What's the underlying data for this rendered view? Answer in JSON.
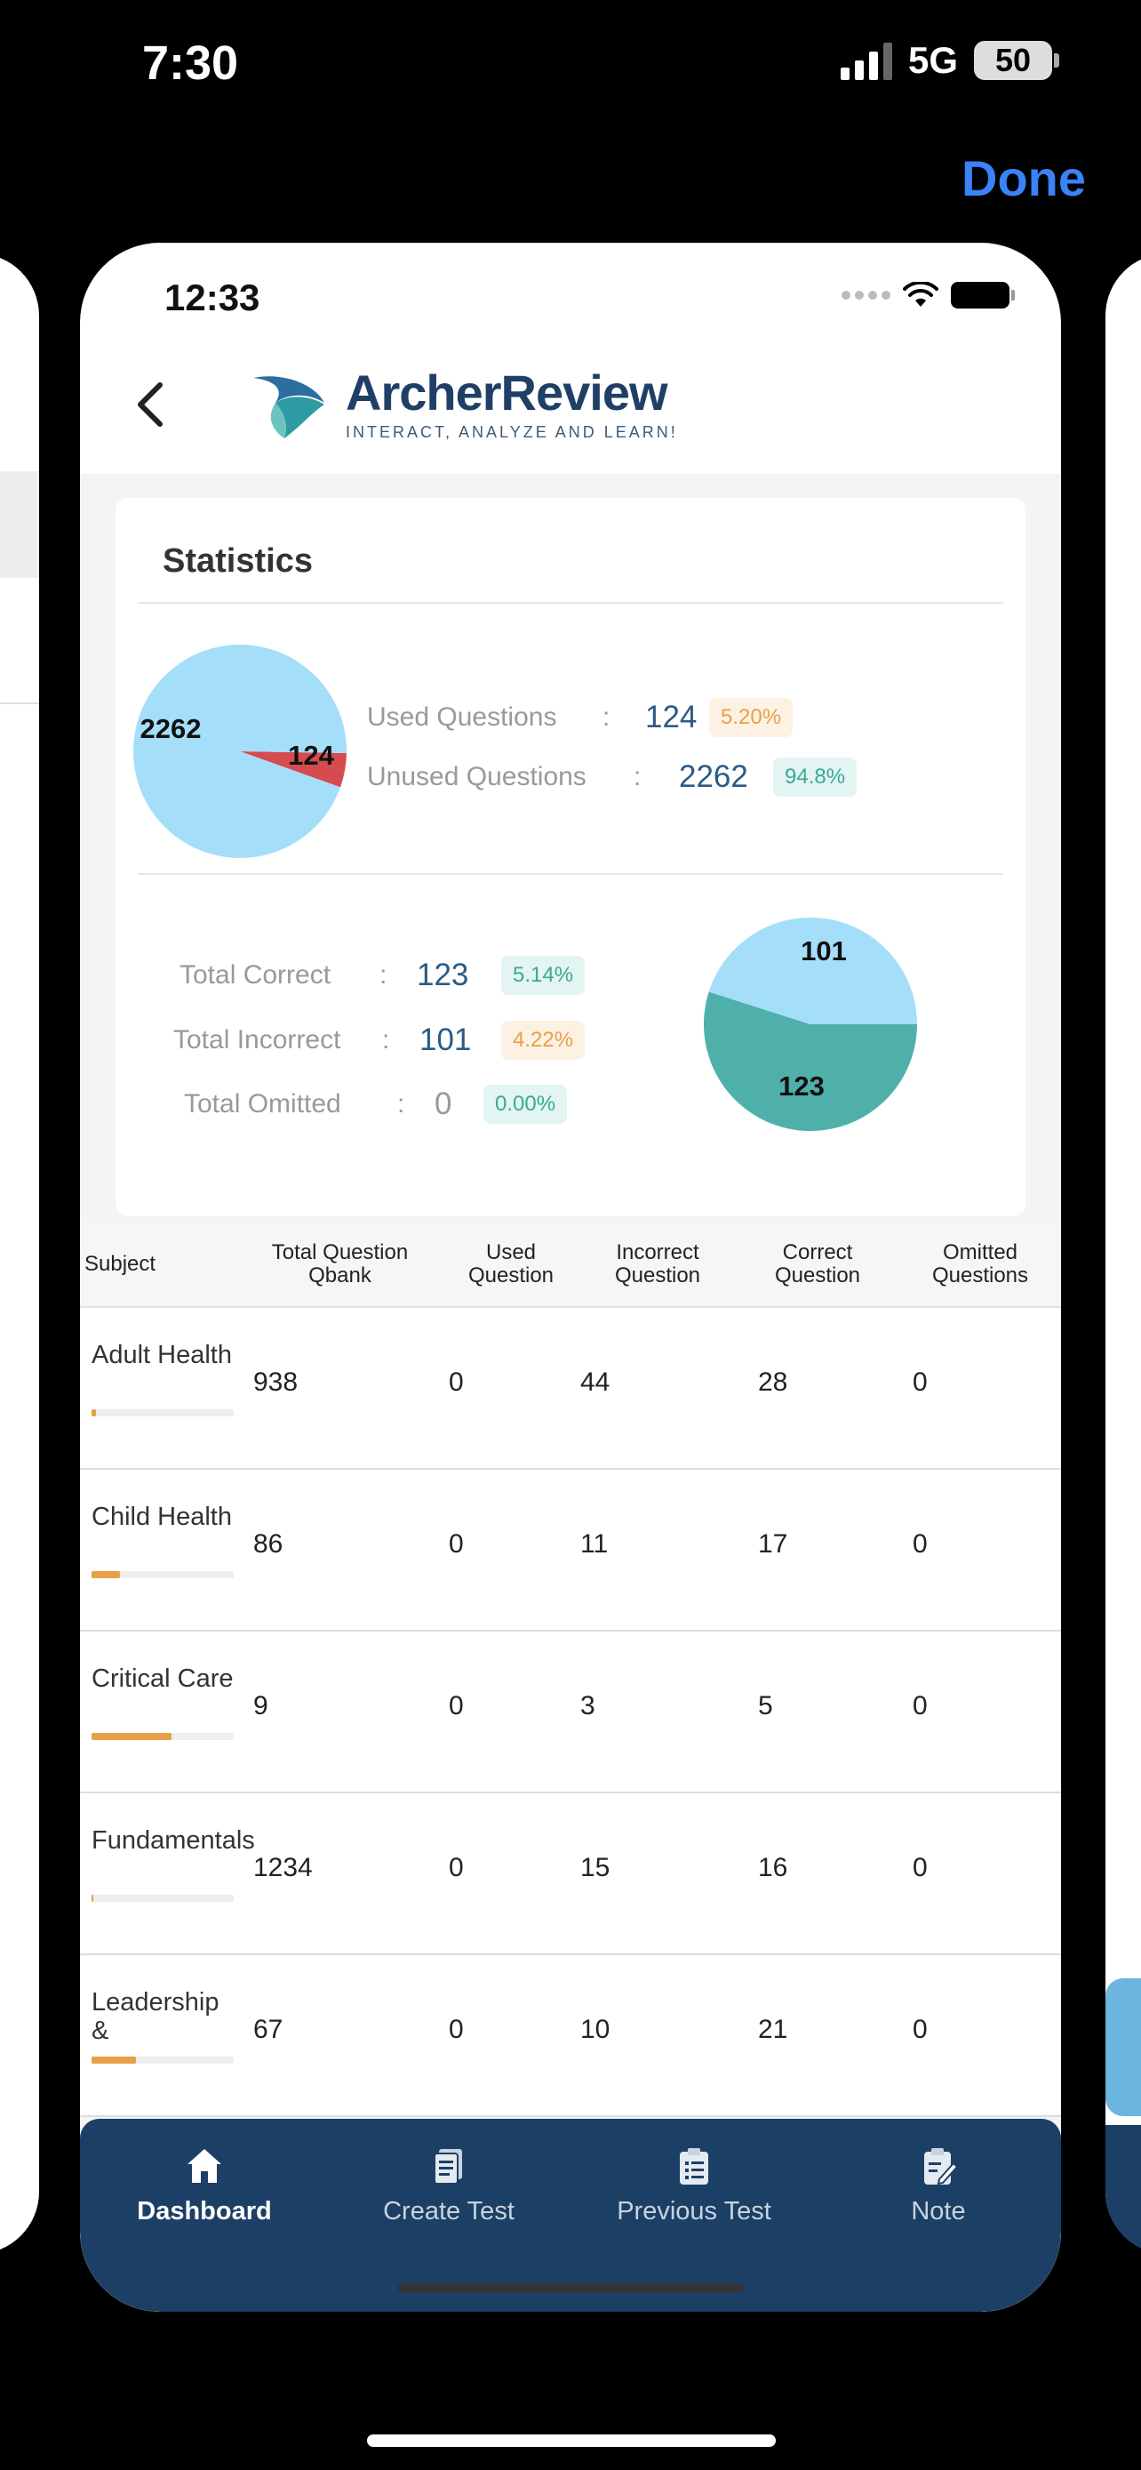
{
  "outer_status": {
    "time": "7:30",
    "network": "5G",
    "battery": "50"
  },
  "done_label": "Done",
  "inner_status": {
    "time": "12:33"
  },
  "header": {
    "brand": "ArcherReview",
    "tagline": "INTERACT, ANALYZE AND LEARN!"
  },
  "statistics": {
    "title": "Statistics",
    "used": {
      "label": "Used Questions",
      "colon": ":",
      "value": "124",
      "percent": "5.20%"
    },
    "unused": {
      "label": "Unused Questions",
      "colon": ":",
      "value": "2262",
      "percent": "94.8%"
    },
    "correct": {
      "label": "Total Correct",
      "colon": ":",
      "value": "123",
      "percent": "5.14%"
    },
    "incorrect": {
      "label": "Total Incorrect",
      "colon": ":",
      "value": "101",
      "percent": "4.22%"
    },
    "omitted": {
      "label": "Total Omitted",
      "colon": ":",
      "value": "0",
      "percent": "0.00%"
    },
    "pie_usage": {
      "slices": [
        {
          "label": "2262",
          "value": 2262,
          "color": "#a5def8"
        },
        {
          "label": "124",
          "value": 124,
          "color": "#d54b4f"
        }
      ]
    },
    "pie_results": {
      "slices": [
        {
          "label": "101",
          "value": 101,
          "color": "#a5def8"
        },
        {
          "label": "123",
          "value": 123,
          "color": "#4fb0aa"
        }
      ]
    }
  },
  "table": {
    "headers": {
      "subject": "Subject",
      "total": "Total Question Qbank",
      "used": "Used Question",
      "incorrect": "Incorrect Question",
      "correct": "Correct Question",
      "omitted": "Omitted Questions"
    },
    "rows": [
      {
        "subject": "Adult Health",
        "total": "938",
        "used": "0",
        "incorrect": "44",
        "correct": "28",
        "omitted": "0",
        "progress": 0.03
      },
      {
        "subject": "Child Health",
        "total": "86",
        "used": "0",
        "incorrect": "11",
        "correct": "17",
        "omitted": "0",
        "progress": 0.2
      },
      {
        "subject": "Critical Care",
        "total": "9",
        "used": "0",
        "incorrect": "3",
        "correct": "5",
        "omitted": "0",
        "progress": 0.56
      },
      {
        "subject": "Fundamentals",
        "total": "1234",
        "used": "0",
        "incorrect": "15",
        "correct": "16",
        "omitted": "0",
        "progress": 0.01
      },
      {
        "subject": "Leadership &",
        "total": "67",
        "used": "0",
        "incorrect": "10",
        "correct": "21",
        "omitted": "0",
        "progress": 0.31
      }
    ]
  },
  "nav": {
    "dashboard": "Dashboard",
    "create_test": "Create Test",
    "previous_test": "Previous Test",
    "note": "Note"
  },
  "colors": {
    "navy": "#1c3f66",
    "accent_blue": "#3a82f7",
    "orange": "#e8a047",
    "teal": "#4fb0aa"
  }
}
